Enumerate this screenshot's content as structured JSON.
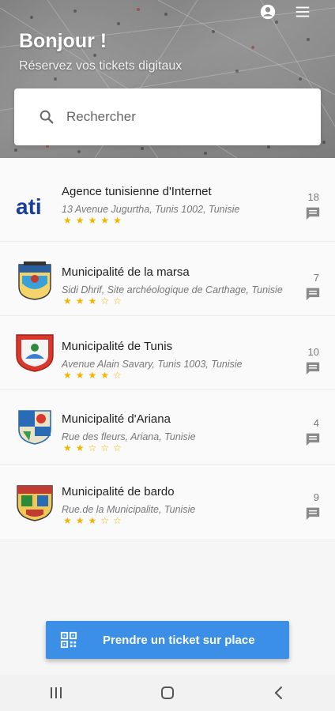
{
  "header": {
    "greeting": "Bonjour !",
    "subtitle": "Réservez vos tickets digitaux",
    "icons": [
      "account-icon",
      "menu-icon"
    ]
  },
  "search": {
    "placeholder": "Rechercher",
    "icon": "search-icon"
  },
  "agencies": [
    {
      "name": "Agence tunisienne d'Internet",
      "address": "13 Avenue Jugurtha, Tunis 1002, Tunisie",
      "rating": 5,
      "count": "18",
      "logo": "ati-logo"
    },
    {
      "name": "Municipalité de la marsa",
      "address": "Sidi Dhrif, Site archéologique de Carthage, Tunisie",
      "rating": 3,
      "count": "7",
      "logo": "marsa-crest"
    },
    {
      "name": "Municipalité de Tunis",
      "address": "Avenue Alain Savary, Tunis 1003, Tunisie",
      "rating": 4,
      "count": "10",
      "logo": "tunis-crest"
    },
    {
      "name": "Municipalité d'Ariana",
      "address": "Rue des fleurs, Ariana, Tunisie",
      "rating": 2,
      "count": "4",
      "logo": "ariana-crest"
    },
    {
      "name": "Municipalité de bardo",
      "address": "Rue.de la Municipalite, Tunisie",
      "rating": 3,
      "count": "9",
      "logo": "bardo-crest"
    }
  ],
  "cta": {
    "label": "Prendre un ticket sur place",
    "icon": "qr-code-icon"
  },
  "colors": {
    "accent": "#3b8fe6",
    "star": "#f2b400"
  }
}
